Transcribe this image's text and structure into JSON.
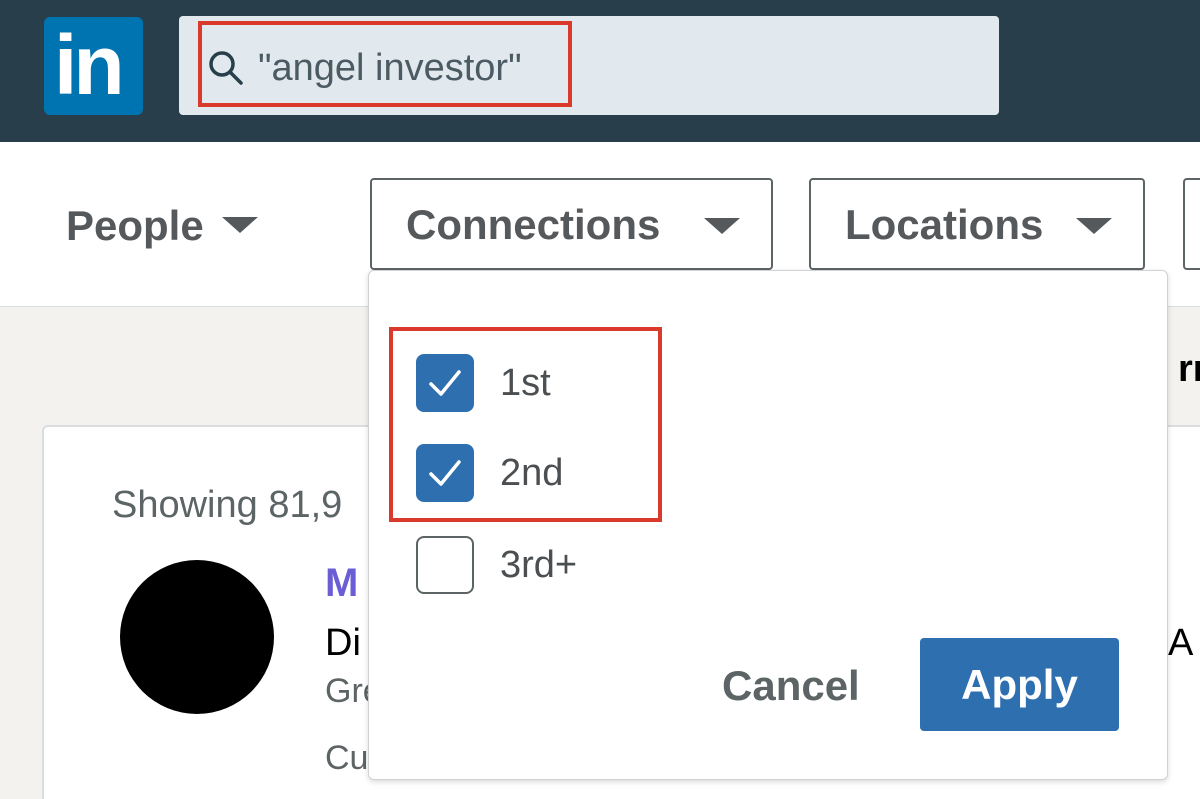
{
  "brand": {
    "logo_text": "in",
    "color": "#0073b1"
  },
  "search": {
    "icon": "search-icon",
    "query": "\"angel investor\""
  },
  "filters": {
    "people_label": "People",
    "connections_label": "Connections",
    "locations_label": "Locations"
  },
  "dropdown": {
    "options": [
      {
        "label": "1st",
        "checked": true
      },
      {
        "label": "2nd",
        "checked": true
      },
      {
        "label": "3rd+",
        "checked": false
      }
    ],
    "cancel_label": "Cancel",
    "apply_label": "Apply"
  },
  "results": {
    "showing_text": "Showing 81,9",
    "first": {
      "name_partial": "M",
      "title_partial": "Di",
      "location_partial": "Gre",
      "current_partial": "Cu",
      "title_right_partial": "A"
    },
    "peek_right_text": "rn"
  },
  "colors": {
    "header_bg": "#283e4a",
    "highlight": "#d93a2b",
    "accent": "#2e6fb0"
  }
}
